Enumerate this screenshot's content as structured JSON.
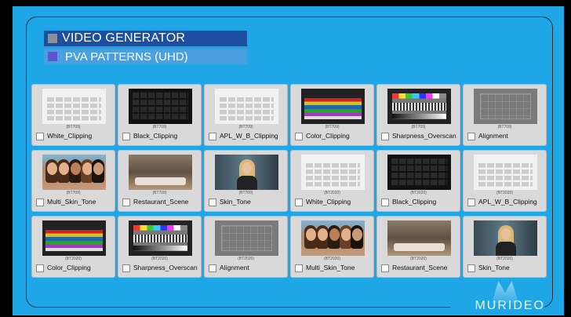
{
  "header": {
    "title": "VIDEO GENERATOR",
    "subtitle": "PVA PATTERNS (UHD)"
  },
  "colors": {
    "background": "#1ea6e6",
    "title_bar": "#1c4fa0",
    "subtitle_bar": "#4a9fe0",
    "tile": "#d9d9d9"
  },
  "patterns": [
    {
      "label": "White_Clipping",
      "standard": "(BT709)",
      "type": "white"
    },
    {
      "label": "Black_Clipping",
      "standard": "(BT709)",
      "type": "black"
    },
    {
      "label": "APL_W_B_Clipping",
      "standard": "(BT709)",
      "type": "white"
    },
    {
      "label": "Color_Clipping",
      "standard": "(BT709)",
      "type": "color"
    },
    {
      "label": "Sharpness_Overscan",
      "standard": "(BT709)",
      "type": "sharp"
    },
    {
      "label": "Alignment",
      "standard": "(BT709)",
      "type": "align"
    },
    {
      "label": "Multi_Skin_Tone",
      "standard": "(BT709)",
      "type": "people"
    },
    {
      "label": "Restaurant_Scene",
      "standard": "(BT709)",
      "type": "rest"
    },
    {
      "label": "Skin_Tone",
      "standard": "(BT709)",
      "type": "skin"
    },
    {
      "label": "White_Clipping",
      "standard": "(BT2020)",
      "type": "white"
    },
    {
      "label": "Black_Clipping",
      "standard": "(BT2020)",
      "type": "black"
    },
    {
      "label": "APL_W_B_Clipping",
      "standard": "(BT2020)",
      "type": "white"
    },
    {
      "label": "Color_Clipping",
      "standard": "(BT2020)",
      "type": "color"
    },
    {
      "label": "Sharpness_Overscan",
      "standard": "(BT2020)",
      "type": "sharp"
    },
    {
      "label": "Alignment",
      "standard": "(BT2020)",
      "type": "align"
    },
    {
      "label": "Multi_Skin_Tone",
      "standard": "(BT2020)",
      "type": "people"
    },
    {
      "label": "Restaurant_Scene",
      "standard": "(BT2020)",
      "type": "rest"
    },
    {
      "label": "Skin_Tone",
      "standard": "(BT2020)",
      "type": "skin"
    }
  ],
  "brand": "MURIDEO"
}
